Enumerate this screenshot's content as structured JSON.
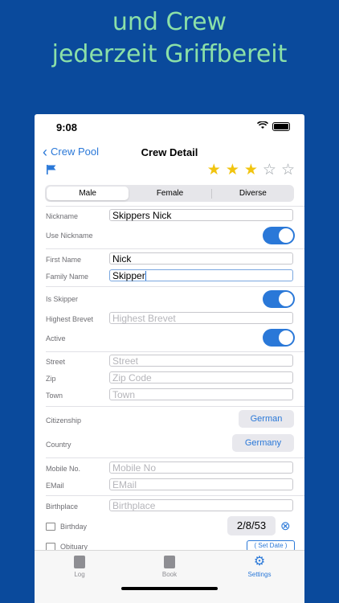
{
  "headline": {
    "line1": "und Crew",
    "line2": "jederzeit Griffbereit"
  },
  "status": {
    "time": "9:08"
  },
  "nav": {
    "back_label": "Crew Pool",
    "title": "Crew Detail"
  },
  "rating": {
    "value": 3,
    "max": 5
  },
  "gender": {
    "options": [
      "Male",
      "Female",
      "Diverse"
    ],
    "selected": "Male"
  },
  "form": {
    "nickname": {
      "label": "Nickname",
      "value": "Skippers Nick"
    },
    "use_nickname": {
      "label": "Use Nickname",
      "on": true
    },
    "first_name": {
      "label": "First Name",
      "value": "Nick"
    },
    "family_name": {
      "label": "Family Name",
      "value": "Skipper"
    },
    "is_skipper": {
      "label": "Is Skipper",
      "on": true
    },
    "highest_brevet": {
      "label": "Highest Brevet",
      "placeholder": "Highest Brevet"
    },
    "active": {
      "label": "Active",
      "on": true
    },
    "street": {
      "label": "Street",
      "placeholder": "Street"
    },
    "zip": {
      "label": "Zip",
      "placeholder": "Zip Code"
    },
    "town": {
      "label": "Town",
      "placeholder": "Town"
    },
    "citizenship": {
      "label": "Citizenship",
      "value": "German"
    },
    "country": {
      "label": "Country",
      "value": "Germany"
    },
    "mobile": {
      "label": "Mobile No.",
      "placeholder": "Mobile No"
    },
    "email": {
      "label": "EMail",
      "placeholder": "EMail"
    },
    "birthplace": {
      "label": "Birthplace",
      "placeholder": "Birthplace"
    },
    "birthday": {
      "label": "Birthday",
      "value": "2/8/53",
      "clear": "⊗"
    },
    "obituary": {
      "label": "Obituary",
      "button": "( Set Date )"
    }
  },
  "tabs": [
    {
      "label": "Log"
    },
    {
      "label": "Book"
    },
    {
      "label": "Settings"
    }
  ],
  "colors": {
    "background": "#0a4a9c",
    "headline": "#8be0a8",
    "accent": "#2a78d8",
    "star": "#f1c40f"
  }
}
